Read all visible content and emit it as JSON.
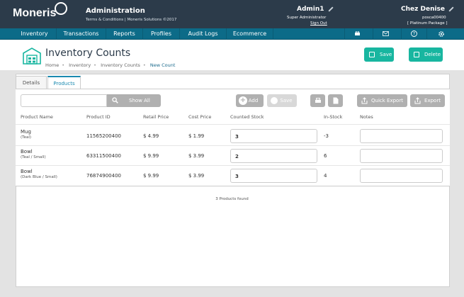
{
  "brand": {
    "logo_text": "Moneris"
  },
  "top": {
    "title": "Administration",
    "subtitle": "Terms & Conditions | Moneris Solutions ©2017",
    "user_name": "Admin1",
    "user_role": "Super Administrator",
    "sign_out": "Sign Out",
    "store_name": "Chez Denise",
    "store_id": "posca00400",
    "store_package": "[ Platinum Package ]"
  },
  "nav": {
    "items": [
      "Inventory",
      "Transactions",
      "Reports",
      "Profiles",
      "Audit Logs",
      "Ecommerce"
    ],
    "icons": [
      "printer-icon",
      "mail-icon",
      "help-icon",
      "settings-icon"
    ]
  },
  "page": {
    "title": "Inventory Counts",
    "breadcrumb": [
      "Home",
      "Inventory",
      "Inventory Counts",
      "New Count"
    ],
    "save_label": "Save",
    "delete_label": "Delete"
  },
  "tabs": [
    "Details",
    "Products"
  ],
  "toolbar": {
    "search_placeholder": "",
    "show_all": "Show All",
    "add": "Add",
    "save": "Save",
    "quick_export": "Quick Export",
    "export": "Export"
  },
  "table": {
    "headers": [
      "Product Name",
      "Product ID",
      "Retail Price",
      "Cost Price",
      "Counted Stock",
      "In-Stock",
      "Notes"
    ],
    "rows": [
      {
        "name": "Mug",
        "variant": "(Teal)",
        "id": "11565200400",
        "retail": "$ 4.99",
        "cost": "$ 1.99",
        "counted": "3",
        "instock": "-3",
        "notes": ""
      },
      {
        "name": "Bowl",
        "variant": "(Teal / Small)",
        "id": "63311500400",
        "retail": "$ 9.99",
        "cost": "$ 3.99",
        "counted": "2",
        "instock": "6",
        "notes": ""
      },
      {
        "name": "Bowl",
        "variant": "(Dark Blue / Small)",
        "id": "76874900400",
        "retail": "$ 9.99",
        "cost": "$ 3.99",
        "counted": "3",
        "instock": "4",
        "notes": ""
      }
    ],
    "found_text": "3 Products found"
  },
  "colors": {
    "topbar": "#2c3b4a",
    "navbar": "#0c6b88",
    "accent": "#18b6a0"
  }
}
